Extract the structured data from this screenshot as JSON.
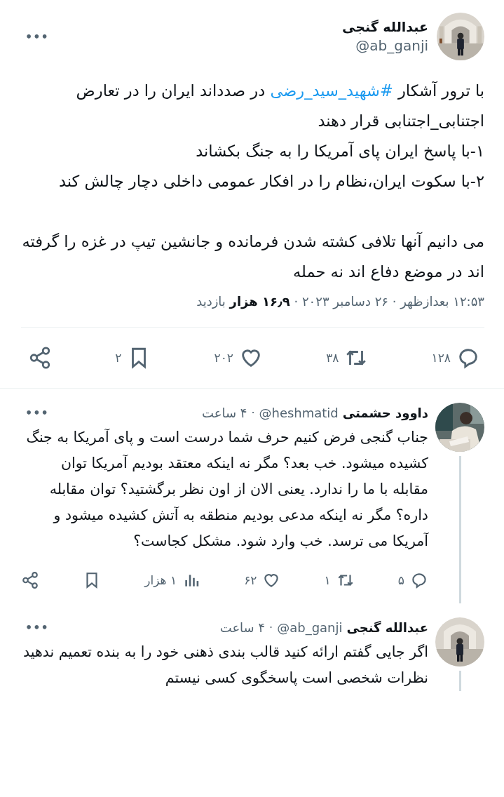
{
  "tweet": {
    "author": {
      "name": "عبدالله گنجی",
      "handle": "@ab_ganji"
    },
    "menu": "•••",
    "body": [
      {
        "lines": [
          {
            "segments": [
              {
                "kind": "text",
                "text": "با ترور آشکار "
              },
              {
                "kind": "hashtag",
                "text": "#شهید_سید_رضی"
              },
              {
                "kind": "text",
                "text": " در صدداند ایران را در تعارض اجتنابی_اجتنابی قرار دهند"
              }
            ]
          },
          {
            "segments": [
              {
                "kind": "text",
                "text": "۱-با پاسخ ایران پای آمریکا را به جنگ بکشاند"
              }
            ]
          },
          {
            "segments": [
              {
                "kind": "text",
                "text": "۲-با سکوت ایران،نظام را در افکار عمومی داخلی دچار چالش کند"
              }
            ]
          }
        ]
      },
      {
        "lines": [
          {
            "segments": [
              {
                "kind": "text",
                "text": "می دانیم آنها تلافی کشته شدن فرمانده و جانشین تیپ در غزه را گرفته اند در موضع دفاع اند نه حمله"
              }
            ]
          }
        ]
      }
    ],
    "meta": "۱۲:۵۳ بعدازظهر · ۲۶ دسامبر ۲۰۲۳ · **۱۶٫۹ هزار** بازدید",
    "actions": [
      {
        "kind": "reply",
        "count": "۱۲۸"
      },
      {
        "kind": "retweet",
        "count": "۳۸"
      },
      {
        "kind": "like",
        "count": "۲۰۲"
      },
      {
        "kind": "bookmark",
        "count": "۲"
      },
      {
        "kind": "share"
      }
    ]
  },
  "replies": [
    {
      "author": {
        "name": "داوود حشمتی",
        "handle": "@heshmatid"
      },
      "separator": "·",
      "time": "۴ ساعت",
      "menu": "•••",
      "thread_line": true,
      "text": "جناب گنجی فرض کنیم حرف شما درست است و پای آمریکا به جنگ کشیده میشود. خب بعد؟ مگر نه اینکه معتقد بودیم آمریکا توان مقابله با ما را ندارد. یعنی الان از اون نظر برگشتید؟ توان مقابله داره؟ مگر نه اینکه مدعی بودیم منطقه به آتش کشیده میشود و آمریکا می ترسد. خب وارد شود. مشکل کجاست؟",
      "actions": [
        {
          "kind": "reply",
          "count": "۵"
        },
        {
          "kind": "retweet",
          "count": "۱"
        },
        {
          "kind": "like",
          "count": "۶۲"
        },
        {
          "kind": "views",
          "count": "۱ هزار"
        },
        {
          "kind": "bookmark"
        },
        {
          "kind": "share"
        }
      ]
    },
    {
      "author": {
        "name": "عبدالله گنجی",
        "handle": "@ab_ganji"
      },
      "separator": "·",
      "time": "۴ ساعت",
      "menu": "•••",
      "thread_line": true,
      "text": "اگر جایی گفتم ارائه کنید قالب بندی ذهنی خود را به بنده تعمیم ندهید نظرات شخصی است پاسخگوی کسی نیستم"
    }
  ]
}
